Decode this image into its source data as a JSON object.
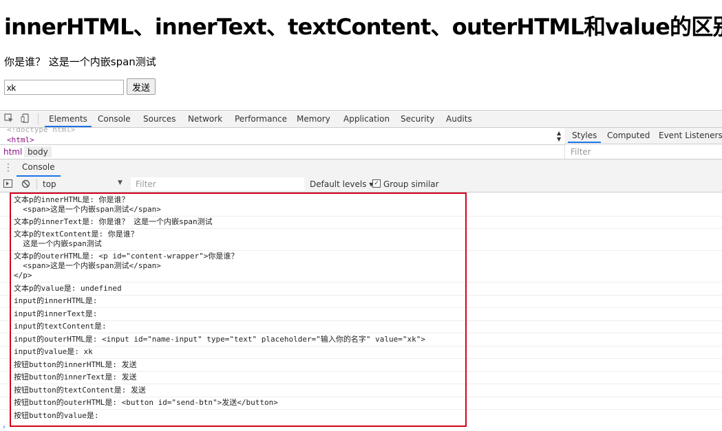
{
  "page": {
    "title": "innerHTML、innerText、textContent、outerHTML和value的区别",
    "paragraph": "你是谁？ 这是一个内嵌span测试",
    "input_value": "xk",
    "button_label": "发送"
  },
  "devtools": {
    "tabs": [
      "Elements",
      "Console",
      "Sources",
      "Network",
      "Performance",
      "Memory",
      "Application",
      "Security",
      "Audits"
    ],
    "active_tab": "Elements",
    "elements_doctype": "<!doctype html>",
    "elements_html": "<html>",
    "breadcrumbs": [
      "html",
      "body"
    ],
    "side_tabs": [
      "Styles",
      "Computed",
      "Event Listeners"
    ],
    "side_filter_placeholder": "Filter",
    "drawer_tab": "Console",
    "console_toolbar": {
      "context": "top",
      "filter_placeholder": "Filter",
      "levels": "Default levels ▾",
      "group_similar": "Group similar",
      "group_similar_checked": true
    },
    "logs": [
      "文本p的innerHTML是: 你是谁？\n  <span>这是一个内嵌span测试</span>",
      "文本p的innerText是: 你是谁？ 这是一个内嵌span测试",
      "文本p的textContent是: 你是谁？\n  这是一个内嵌span测试",
      "文本p的outerHTML是: <p id=\"content-wrapper\">你是谁？\n  <span>这是一个内嵌span测试</span>\n</p>",
      "文本p的value是: undefined",
      "input的innerHTML是:",
      "input的innerText是:",
      "input的textContent是:",
      "input的outerHTML是: <input id=\"name-input\" type=\"text\" placeholder=\"输入你的名字\" value=\"xk\">",
      "input的value是: xk",
      "按钮button的innerHTML是: 发送",
      "按钮button的innerText是: 发送",
      "按钮button的textContent是: 发送",
      "按钮button的outerHTML是: <button id=\"send-btn\">发送</button>",
      "按钮button的value是:"
    ],
    "highlight_color": "#d0021b",
    "accent_color": "#1a73e8"
  }
}
